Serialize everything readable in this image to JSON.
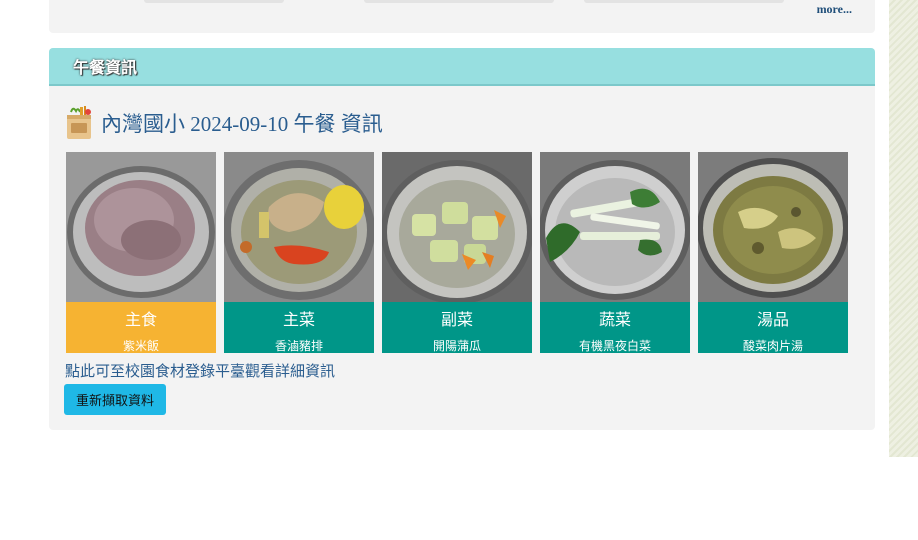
{
  "top_panel": {
    "more_label": "more..."
  },
  "lunch": {
    "header_title": "午餐資訊",
    "info_title": "內灣國小 2024-09-10 午餐 資訊",
    "dishes": [
      {
        "category": "主食",
        "name": "紫米飯",
        "color": "#f6b332",
        "photo": "rice"
      },
      {
        "category": "主菜",
        "name": "香滷豬排",
        "color": "#009688",
        "photo": "pork"
      },
      {
        "category": "副菜",
        "name": "開陽蒲瓜",
        "color": "#009688",
        "photo": "gourd"
      },
      {
        "category": "蔬菜",
        "name": "有機黑夜白菜",
        "color": "#009688",
        "photo": "greens"
      },
      {
        "category": "湯品",
        "name": "酸菜肉片湯",
        "color": "#009688",
        "photo": "soup"
      }
    ],
    "detail_link": "點此可至校園食材登錄平臺觀看詳細資訊",
    "refresh_label": "重新擷取資料"
  }
}
